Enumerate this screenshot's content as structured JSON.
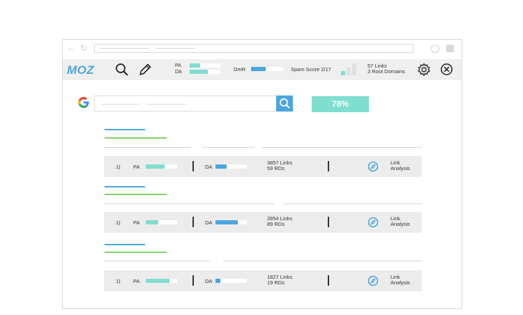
{
  "toolbar": {
    "logo": "MOZ",
    "pa_label": "PA",
    "da_label": "DA",
    "pa_fraction": 0.35,
    "da_fraction": 0.6,
    "dmr_label": "DmR",
    "dmr_fraction": 0.45,
    "spam_score_label": "Spam Score 2/17",
    "links_label": "57 Links",
    "root_domains_label": "3 Root Domains"
  },
  "colors": {
    "accent_blue": "#4aa6e0",
    "accent_teal": "#7fded0",
    "title_green": "#7ed36b",
    "spam_bar": "#7fded0",
    "spam_bar_empty": "#e0e0e0"
  },
  "search": {
    "percent_label": "78%"
  },
  "results": [
    {
      "rank": "1)",
      "pa_label": "PA",
      "pa_fraction": 0.6,
      "da_label": "DA",
      "da_fraction": 0.35,
      "links": "3857 Links",
      "rds": "59 RDs",
      "analysis_line1": "Link",
      "analysis_line2": "Analysis"
    },
    {
      "rank": "1)",
      "pa_label": "PA",
      "pa_fraction": 0.4,
      "da_label": "DA",
      "da_fraction": 0.7,
      "links": "2854 Links",
      "rds": "89 RDs",
      "analysis_line1": "Link",
      "analysis_line2": "Analysis"
    },
    {
      "rank": "1)",
      "pa_label": "PA",
      "pa_fraction": 0.75,
      "da_label": "DA",
      "da_fraction": 0.15,
      "links": "1827 Links",
      "rds": "19 RDs",
      "analysis_line1": "Link",
      "analysis_line2": "Analysis"
    }
  ]
}
